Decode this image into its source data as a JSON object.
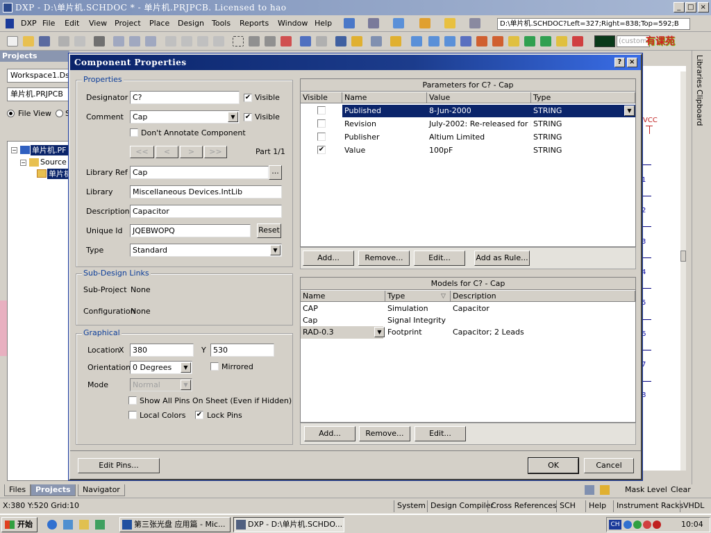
{
  "app": {
    "title": "DXP - D:\\单片机.SCHDOC * - 单片机.PRJPCB. Licensed to hao",
    "path": "D:\\单片机.SCHDOC?Left=327;Right=838;Top=592;B",
    "logo_text": "有课苑",
    "custom_label": "(custom"
  },
  "menu": [
    "DXP",
    "File",
    "Edit",
    "View",
    "Project",
    "Place",
    "Design",
    "Tools",
    "Reports",
    "Window",
    "Help"
  ],
  "left_panel": {
    "title": "Projects",
    "workspace": "Workspace1.Dsn",
    "project": "单片机.PRJPCB",
    "file_view": "File View",
    "s_label": "S",
    "tree": [
      "单片机.PF",
      "Source D",
      "单片机"
    ]
  },
  "right_tabs": [
    "Libraries",
    "Clipboard"
  ],
  "schematic": {
    "vcc": "VCC",
    "pins": [
      "1",
      "2",
      "3",
      "4",
      "5",
      "6",
      "7",
      "8"
    ]
  },
  "dialog": {
    "title": "Component Properties",
    "properties": {
      "group": "Properties",
      "designator_label": "Designator",
      "designator_value": "C?",
      "comment_label": "Comment",
      "comment_value": "Cap",
      "visible": "Visible",
      "dont_annotate": "Don't Annotate Component",
      "nav": [
        "<<",
        "<",
        ">",
        ">>"
      ],
      "part": "Part 1/1",
      "libref_label": "Library Ref",
      "libref_value": "Cap",
      "libref_browse": "...",
      "library_label": "Library",
      "library_value": "Miscellaneous Devices.IntLib",
      "desc_label": "Description",
      "desc_value": "Capacitor",
      "uid_label": "Unique Id",
      "uid_value": "JQEBWOPQ",
      "reset": "Reset",
      "type_label": "Type",
      "type_value": "Standard"
    },
    "subdesign": {
      "group": "Sub-Design Links",
      "subproject_label": "Sub-Project",
      "subproject_value": "None",
      "config_label": "Configuration",
      "config_value": "None"
    },
    "graphical": {
      "group": "Graphical",
      "location_label": "Location",
      "x_label": "X",
      "x_value": "380",
      "y_label": "Y",
      "y_value": "530",
      "orientation_label": "Orientation",
      "orientation_value": "0 Degrees",
      "mirrored": "Mirrored",
      "mode_label": "Mode",
      "mode_value": "Normal",
      "show_pins": "Show All Pins On Sheet (Even if Hidden)",
      "local_colors": "Local Colors",
      "lock_pins": "Lock Pins"
    },
    "parameters": {
      "title": "Parameters for C? - Cap",
      "columns": [
        "Visible",
        "Name",
        "Value",
        "Type"
      ],
      "rows": [
        {
          "visible": false,
          "name": "Published",
          "value": "8-Jun-2000",
          "type": "STRING",
          "selected": true
        },
        {
          "visible": false,
          "name": "Revision",
          "value": "July-2002: Re-released for DXP",
          "type": "STRING",
          "selected": false
        },
        {
          "visible": false,
          "name": "Publisher",
          "value": "Altium Limited",
          "type": "STRING",
          "selected": false
        },
        {
          "visible": true,
          "name": "Value",
          "value": "100pF",
          "type": "STRING",
          "selected": false
        }
      ],
      "buttons": [
        "Add...",
        "Remove...",
        "Edit...",
        "Add as Rule..."
      ]
    },
    "models": {
      "title": "Models for C? - Cap",
      "columns": [
        "Name",
        "Type",
        "Description"
      ],
      "rows": [
        {
          "name": "CAP",
          "type": "Simulation",
          "description": "Capacitor"
        },
        {
          "name": "Cap",
          "type": "Signal Integrity",
          "description": ""
        },
        {
          "name": "RAD-0.3",
          "type": "Footprint",
          "description": "Capacitor; 2 Leads"
        }
      ],
      "buttons": [
        "Add...",
        "Remove...",
        "Edit..."
      ]
    },
    "edit_pins": "Edit Pins...",
    "ok": "OK",
    "cancel": "Cancel"
  },
  "bottom_tabs": [
    "Files",
    "Projects",
    "Navigator"
  ],
  "bottom_right": {
    "mask_level": "Mask Level",
    "clear": "Clear"
  },
  "status": {
    "coords": "X:380 Y:520  Grid:10",
    "items": [
      "System",
      "Design Compiler",
      "Cross References",
      "SCH",
      "Help",
      "Instrument Racks",
      "VHDL"
    ]
  },
  "taskbar": {
    "start": "开始",
    "tasks": [
      "第三张光盘 应用篇 - Mic...",
      "DXP - D:\\单片机.SCHDO..."
    ],
    "tray_lang": "CH",
    "clock": "10:04"
  }
}
